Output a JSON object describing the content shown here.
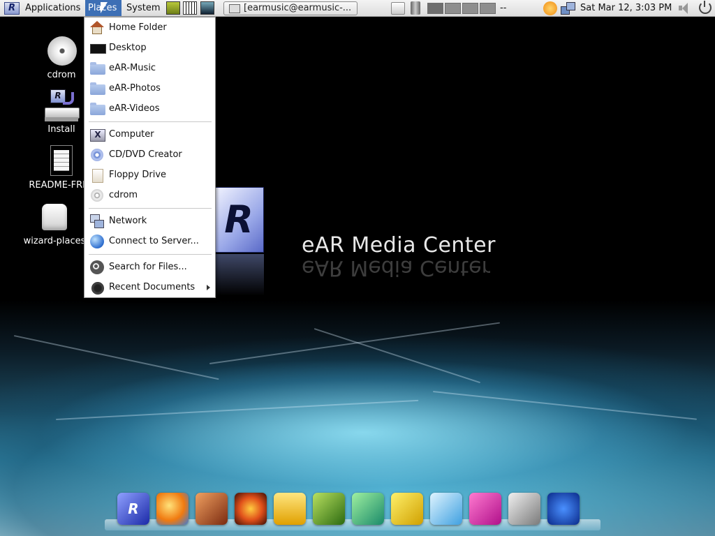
{
  "panel": {
    "menus": [
      {
        "label": "Applications"
      },
      {
        "label": "Places"
      },
      {
        "label": "System"
      }
    ],
    "logo_letter": "R",
    "task_button": "[earmusic@earmusic-...",
    "workspace_label": "--",
    "clock": "Sat Mar 12,  3:03 PM"
  },
  "desktop": {
    "icons": [
      {
        "label": "cdrom",
        "icon": "cdrom-icon"
      },
      {
        "label": "Install",
        "icon": "install-icon"
      },
      {
        "label": "README-FREE",
        "icon": "document-icon"
      },
      {
        "label": "wizard-places",
        "icon": "wizard-icon"
      }
    ],
    "brand": "eAR Media Center",
    "logo_letter": "R"
  },
  "places_menu": {
    "items": [
      {
        "label": "Home Folder",
        "icon": "home-icon"
      },
      {
        "label": "Desktop",
        "icon": "desktop-icon"
      },
      {
        "label": "eAR-Music",
        "icon": "folder-icon"
      },
      {
        "label": "eAR-Photos",
        "icon": "folder-icon"
      },
      {
        "label": "eAR-Videos",
        "icon": "folder-icon"
      },
      {
        "label": "Computer",
        "icon": "computer-icon"
      },
      {
        "label": "CD/DVD Creator",
        "icon": "cd-dvd-creator-icon"
      },
      {
        "label": "Floppy Drive",
        "icon": "floppy-icon"
      },
      {
        "label": "cdrom",
        "icon": "cdrom-icon"
      },
      {
        "label": "Network",
        "icon": "network-icon"
      },
      {
        "label": "Connect to Server...",
        "icon": "connect-server-icon"
      },
      {
        "label": "Search for Files...",
        "icon": "search-icon"
      },
      {
        "label": "Recent Documents",
        "icon": "recent-documents-icon"
      }
    ]
  },
  "dock": {
    "logo_letter": "R",
    "items": [
      {
        "icon": "ear-logo-icon"
      },
      {
        "icon": "browser-icon"
      },
      {
        "icon": "guitar-icon"
      },
      {
        "icon": "media-player-icon"
      },
      {
        "icon": "coffee-icon"
      },
      {
        "icon": "photo-editor-icon"
      },
      {
        "icon": "messenger-icon"
      },
      {
        "icon": "office-icon"
      },
      {
        "icon": "web-editor-icon"
      },
      {
        "icon": "itunes-icon"
      },
      {
        "icon": "settings-icon"
      },
      {
        "icon": "power-icon"
      }
    ]
  }
}
